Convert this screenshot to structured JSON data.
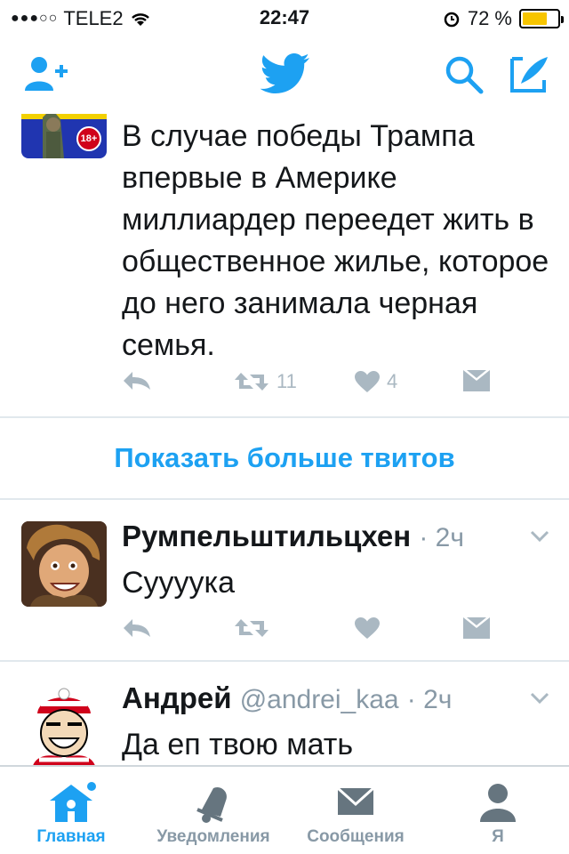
{
  "status_bar": {
    "signal": "●●●○○",
    "carrier": "TELE2",
    "time": "22:47",
    "battery_text": "72 %",
    "battery_level": 0.72
  },
  "nav": {
    "icons": [
      "add-user-icon",
      "twitter-bird-icon",
      "search-icon",
      "compose-icon"
    ]
  },
  "tweets": [
    {
      "avatar_badge": "18+",
      "text": "В случае победы Трампа впервые в Америке миллиардер переедет жить в общественное жилье, которое до него занимала черная семья.",
      "retweets": "11",
      "likes": "4"
    },
    {
      "name": "Румпельштильцхен",
      "time": "· 2ч",
      "text": "Суууука"
    },
    {
      "name": "Андрей",
      "handle": "@andrei_kaa",
      "time": "· 2ч",
      "text": "Да еп твою мать"
    }
  ],
  "show_more": "Показать больше твитов",
  "tabs": [
    {
      "label": "Главная",
      "icon": "home-icon",
      "active": true
    },
    {
      "label": "Уведомления",
      "icon": "bell-icon"
    },
    {
      "label": "Сообщения",
      "icon": "envelope-icon"
    },
    {
      "label": "Я",
      "icon": "profile-icon"
    }
  ],
  "colors": {
    "accent": "#1da1f2",
    "text": "#14171a",
    "muted": "#8899a6",
    "action_icon": "#aab8c2",
    "battery": "#f7c500"
  }
}
